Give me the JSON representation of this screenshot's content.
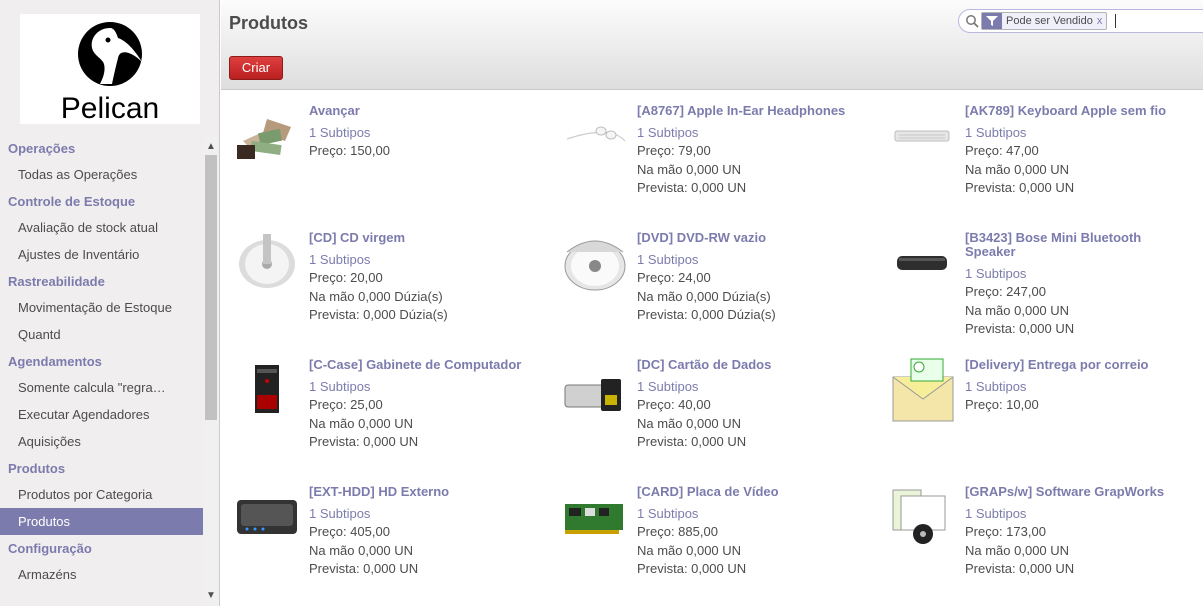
{
  "logo": {
    "text": "Pelican"
  },
  "menu": {
    "items": [
      {
        "kind": "section",
        "label": "Operações"
      },
      {
        "kind": "item",
        "label": "Todas as Operações"
      },
      {
        "kind": "section",
        "label": "Controle de Estoque"
      },
      {
        "kind": "item",
        "label": "Avaliação de stock atual"
      },
      {
        "kind": "item",
        "label": "Ajustes de Inventário"
      },
      {
        "kind": "section",
        "label": "Rastreabilidade"
      },
      {
        "kind": "item",
        "label": "Movimentação de Estoque"
      },
      {
        "kind": "item",
        "label": "Quantd"
      },
      {
        "kind": "section",
        "label": "Agendamentos"
      },
      {
        "kind": "item",
        "label": "Somente calcula \"regra…"
      },
      {
        "kind": "item",
        "label": "Executar Agendadores"
      },
      {
        "kind": "item",
        "label": "Aquisições"
      },
      {
        "kind": "section",
        "label": "Produtos"
      },
      {
        "kind": "item",
        "label": "Produtos por Categoria"
      },
      {
        "kind": "item",
        "label": "Produtos",
        "active": true
      },
      {
        "kind": "section",
        "label": "Configuração"
      },
      {
        "kind": "item",
        "label": "Armazéns"
      }
    ]
  },
  "header": {
    "title": "Produtos",
    "create_label": "Criar"
  },
  "search": {
    "facet_label": "Pode ser Vendido",
    "facet_remove": "x"
  },
  "colors": {
    "accent": "#7c7bad",
    "primary_button": "#c62828"
  },
  "products": [
    {
      "name": "Avançar",
      "subtypes": "1 Subtipos",
      "lines": [
        "Preço: 150,00"
      ],
      "image": "money-hands-icon"
    },
    {
      "name": "[A8767] Apple In-Ear Headphones",
      "subtypes": "1 Subtipos",
      "lines": [
        "Preço: 79,00",
        "Na mão 0,000 UN",
        "Prevista: 0,000 UN"
      ],
      "image": "earphones-icon"
    },
    {
      "name": "[AK789] Keyboard Apple sem fio",
      "subtypes": "1 Subtipos",
      "lines": [
        "Preço: 47,00",
        "Na mão 0,000 UN",
        "Prevista: 0,000 UN"
      ],
      "image": "keyboard-icon"
    },
    {
      "name": "[CD] CD virgem",
      "subtypes": "1 Subtipos",
      "lines": [
        "Preço: 20,00",
        "Na mão 0,000 Dúzia(s)",
        "Prevista: 0,000 Dúzia(s)"
      ],
      "image": "cd-spindle-icon"
    },
    {
      "name": "[DVD] DVD-RW vazio",
      "subtypes": "1 Subtipos",
      "lines": [
        "Preço: 24,00",
        "Na mão 0,000 Dúzia(s)",
        "Prevista: 0,000 Dúzia(s)"
      ],
      "image": "dvd-spindle-icon"
    },
    {
      "name": "[B3423] Bose Mini Bluetooth Speaker",
      "subtypes": "1 Subtipos",
      "lines": [
        "Preço: 247,00",
        "Na mão 0,000 UN",
        "Prevista: 0,000 UN"
      ],
      "image": "speaker-icon"
    },
    {
      "name": "[C-Case] Gabinete de Computador",
      "subtypes": "1 Subtipos",
      "lines": [
        "Preço: 25,00",
        "Na mão 0,000 UN",
        "Prevista: 0,000 UN"
      ],
      "image": "computer-case-icon"
    },
    {
      "name": "[DC] Cartão de Dados",
      "subtypes": "1 Subtipos",
      "lines": [
        "Preço: 40,00",
        "Na mão 0,000 UN",
        "Prevista: 0,000 UN"
      ],
      "image": "data-card-icon"
    },
    {
      "name": "[Delivery] Entrega por correio",
      "subtypes": "1 Subtipos",
      "lines": [
        "Preço: 10,00"
      ],
      "image": "mail-icon"
    },
    {
      "name": "[EXT-HDD] HD Externo",
      "subtypes": "1 Subtipos",
      "lines": [
        "Preço: 405,00",
        "Na mão 0,000 UN",
        "Prevista: 0,000 UN"
      ],
      "image": "external-hdd-icon"
    },
    {
      "name": "[CARD] Placa de Vídeo",
      "subtypes": "1 Subtipos",
      "lines": [
        "Preço: 885,00",
        "Na mão 0,000 UN",
        "Prevista: 0,000 UN"
      ],
      "image": "video-card-icon"
    },
    {
      "name": "[GRAPs/w] Software GrapWorks",
      "subtypes": "1 Subtipos",
      "lines": [
        "Preço: 173,00",
        "Na mão 0,000 UN",
        "Prevista: 0,000 UN"
      ],
      "image": "software-box-icon"
    }
  ]
}
